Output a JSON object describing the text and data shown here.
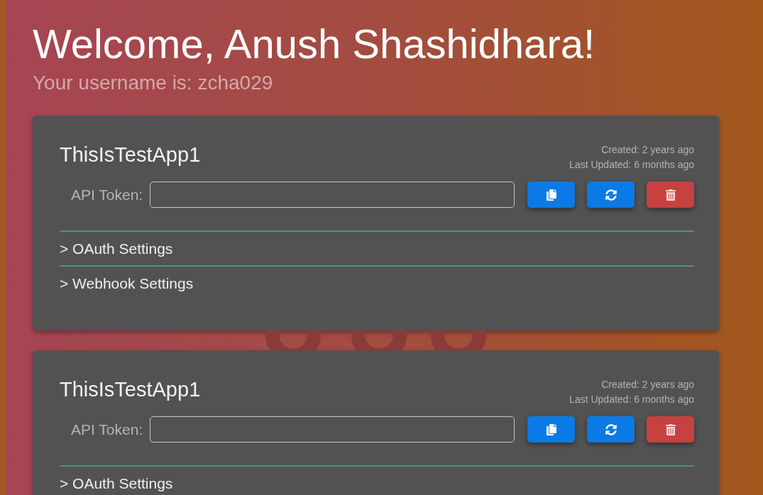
{
  "welcome": {
    "heading": "Welcome, Anush Shashidhara!",
    "subtitle": "Your username is: zcha029"
  },
  "apps": [
    {
      "name": "ThisIsTestApp1",
      "created": "Created: 2 years ago",
      "updated": "Last Updated: 6 months ago",
      "token_label": "API Token:",
      "actions": [
        {
          "kind": "copy"
        },
        {
          "kind": "refresh"
        },
        {
          "kind": "delete"
        }
      ],
      "sections": [
        "> OAuth Settings",
        "> Webhook Settings"
      ]
    },
    {
      "name": "ThisIsTestApp1",
      "created": "Created: 2 years ago",
      "updated": "Last Updated: 6 months ago",
      "token_label": "API Token:",
      "actions": [
        {
          "kind": "copy"
        },
        {
          "kind": "refresh"
        },
        {
          "kind": "delete"
        }
      ],
      "sections": [
        "> OAuth Settings"
      ]
    }
  ]
}
